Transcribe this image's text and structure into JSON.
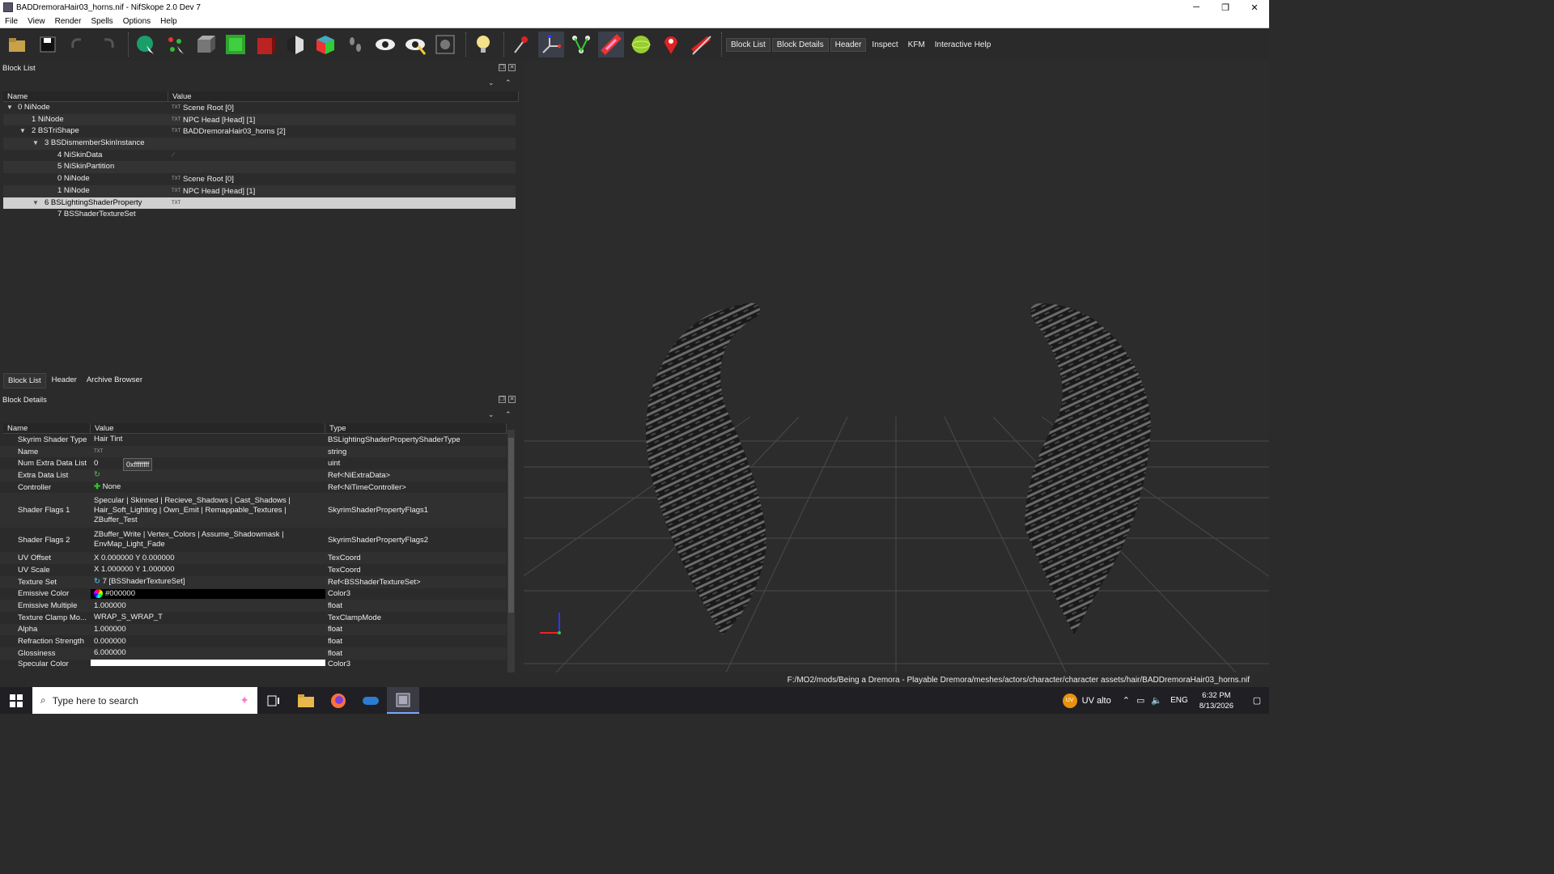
{
  "window": {
    "title": "BADDremoraHair03_horns.nif - NifSkope 2.0 Dev 7",
    "minimize": "─",
    "restore": "❐",
    "close": "✕"
  },
  "menu": [
    "File",
    "View",
    "Render",
    "Spells",
    "Options",
    "Help"
  ],
  "toolbar_text": [
    "Block List",
    "Block Details",
    "Header",
    "Inspect",
    "KFM",
    "Interactive Help"
  ],
  "block_list": {
    "title": "Block List",
    "cols": [
      "Name",
      "Value"
    ],
    "rows": [
      {
        "name": "0 NiNode",
        "value": "Scene Root [0]"
      },
      {
        "name": "1 NiNode",
        "value": "NPC Head [Head] [1]"
      },
      {
        "name": "2 BSTriShape",
        "value": "BADDremoraHair03_horns [2]"
      },
      {
        "name": "3 BSDismemberSkinInstance",
        "value": ""
      },
      {
        "name": "4 NiSkinData",
        "value": ""
      },
      {
        "name": "5 NiSkinPartition",
        "value": ""
      },
      {
        "name": "0 NiNode",
        "value": "Scene Root [0]"
      },
      {
        "name": "1 NiNode",
        "value": "NPC Head [Head] [1]"
      },
      {
        "name": "6 BSLightingShaderProperty",
        "value": ""
      },
      {
        "name": "7 BSShaderTextureSet",
        "value": ""
      }
    ]
  },
  "bottom_tabs": [
    "Block List",
    "Header",
    "Archive Browser"
  ],
  "block_details": {
    "title": "Block Details",
    "cols": [
      "Name",
      "Value",
      "Type"
    ],
    "tooltip": "0xffffffff",
    "rows": [
      {
        "name": "Skyrim Shader Type",
        "value": "Hair Tint",
        "type": "BSLightingShaderPropertyShaderType"
      },
      {
        "name": "Name",
        "value": "",
        "type": "string"
      },
      {
        "name": "Num Extra Data List",
        "value": "0",
        "type": "uint"
      },
      {
        "name": "Extra Data List",
        "value": "",
        "type": "Ref<NiExtraData>"
      },
      {
        "name": "Controller",
        "value": "None",
        "type": "Ref<NiTimeController>"
      },
      {
        "name": "Shader Flags 1",
        "value": "Specular | Skinned | Recieve_Shadows | Cast_Shadows | Hair_Soft_Lighting | Own_Emit | Remappable_Textures | ZBuffer_Test",
        "type": "SkyrimShaderPropertyFlags1"
      },
      {
        "name": "Shader Flags 2",
        "value": "ZBuffer_Write | Vertex_Colors | Assume_Shadowmask | EnvMap_Light_Fade",
        "type": "SkyrimShaderPropertyFlags2"
      },
      {
        "name": "UV Offset",
        "value": "X 0.000000 Y 0.000000",
        "type": "TexCoord"
      },
      {
        "name": "UV Scale",
        "value": "X 1.000000 Y 1.000000",
        "type": "TexCoord"
      },
      {
        "name": "Texture Set",
        "value": "7 [BSShaderTextureSet]",
        "type": "Ref<BSShaderTextureSet>"
      },
      {
        "name": "Emissive Color",
        "value": "#000000",
        "type": "Color3"
      },
      {
        "name": "Emissive Multiple",
        "value": "1.000000",
        "type": "float"
      },
      {
        "name": "Texture Clamp Mo...",
        "value": "WRAP_S_WRAP_T",
        "type": "TexClampMode"
      },
      {
        "name": "Alpha",
        "value": "1.000000",
        "type": "float"
      },
      {
        "name": "Refraction Strength",
        "value": "0.000000",
        "type": "float"
      },
      {
        "name": "Glossiness",
        "value": "6.000000",
        "type": "float"
      },
      {
        "name": "Specular Color",
        "value": "",
        "type": "Color3"
      }
    ]
  },
  "status": {
    "path": "F:/MO2/mods/Being a Dremora - Playable Dremora/meshes/actors/character/character assets/hair/BADDremoraHair03_horns.nif"
  },
  "taskbar": {
    "search_placeholder": "Type here to search",
    "tray_app": "UV alto",
    "lang": "ENG",
    "time": "6:32 PM",
    "date": "8/13/2026"
  },
  "colors": {
    "emissive": "#000000",
    "specular": "#ffffff",
    "accent": "#7aa7ff"
  }
}
